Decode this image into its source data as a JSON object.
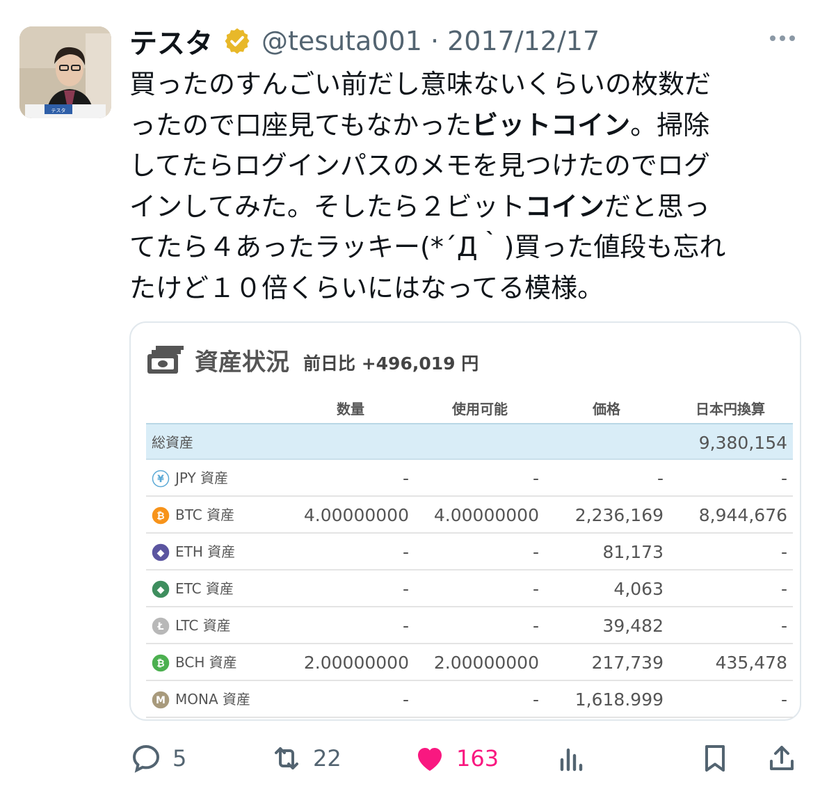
{
  "tweet": {
    "author_name": "テスタ",
    "handle_date": "@tesuta001 · 2017/12/17",
    "avatar_label": "テスタ",
    "lines": [
      [
        {
          "t": "買ったのすんごい前だし意味ないくらいの枚数だ",
          "b": false
        }
      ],
      [
        {
          "t": "ったので口座見てもなかった",
          "b": false
        },
        {
          "t": "ビットコイン",
          "b": true
        },
        {
          "t": "。掃除",
          "b": false
        }
      ],
      [
        {
          "t": "してたらログインパスのメモを見つけたのでログ",
          "b": false
        }
      ],
      [
        {
          "t": "インしてみた。そしたら２ビット",
          "b": false
        },
        {
          "t": "コイン",
          "b": true
        },
        {
          "t": "だと思っ",
          "b": false
        }
      ],
      [
        {
          "t": "てたら４あったラッキー(*´Д｀)買った値段も忘れ",
          "b": false
        }
      ],
      [
        {
          "t": "たけど１０倍くらいにはなってる模様。",
          "b": false
        }
      ]
    ]
  },
  "card": {
    "title": "資産状況",
    "diff": "前日比 +496,019 円",
    "headers": {
      "qty": "数量",
      "avail": "使用可能",
      "price": "価格",
      "jpy": "日本円換算"
    },
    "total": {
      "label": "総資産",
      "jpy": "9,380,154"
    },
    "rows": [
      {
        "label": "JPY 資産",
        "icon": "yen-coin-icon",
        "color": "#5aa9d6",
        "qty": "-",
        "avail": "-",
        "price": "-",
        "jpy": "-"
      },
      {
        "label": "BTC 資産",
        "icon": "bitcoin-coin-icon",
        "color": "#f7931a",
        "qty": "4.00000000",
        "avail": "4.00000000",
        "price": "2,236,169",
        "jpy": "8,944,676"
      },
      {
        "label": "ETH 資産",
        "icon": "ethereum-coin-icon",
        "color": "#5b55a0",
        "qty": "-",
        "avail": "-",
        "price": "81,173",
        "jpy": "-"
      },
      {
        "label": "ETC 資産",
        "icon": "ethereum-classic-coin-icon",
        "color": "#3e8e5e",
        "qty": "-",
        "avail": "-",
        "price": "4,063",
        "jpy": "-"
      },
      {
        "label": "LTC 資産",
        "icon": "litecoin-coin-icon",
        "color": "#b8b8b8",
        "qty": "-",
        "avail": "-",
        "price": "39,482",
        "jpy": "-"
      },
      {
        "label": "BCH 資産",
        "icon": "bitcoin-cash-coin-icon",
        "color": "#4cb050",
        "qty": "2.00000000",
        "avail": "2.00000000",
        "price": "217,739",
        "jpy": "435,478"
      },
      {
        "label": "MONA 資産",
        "icon": "monacoin-coin-icon",
        "color": "#a89a7c",
        "qty": "-",
        "avail": "-",
        "price": "1,618.999",
        "jpy": "-"
      }
    ]
  },
  "actions": {
    "reply_count": "5",
    "retweet_count": "22",
    "like_count": "163"
  },
  "colors": {
    "text": "#0f1419",
    "secondary": "#536471",
    "like": "#f91880",
    "verified_gold": "#e8b829",
    "total_row_bg": "#d9edf7"
  }
}
